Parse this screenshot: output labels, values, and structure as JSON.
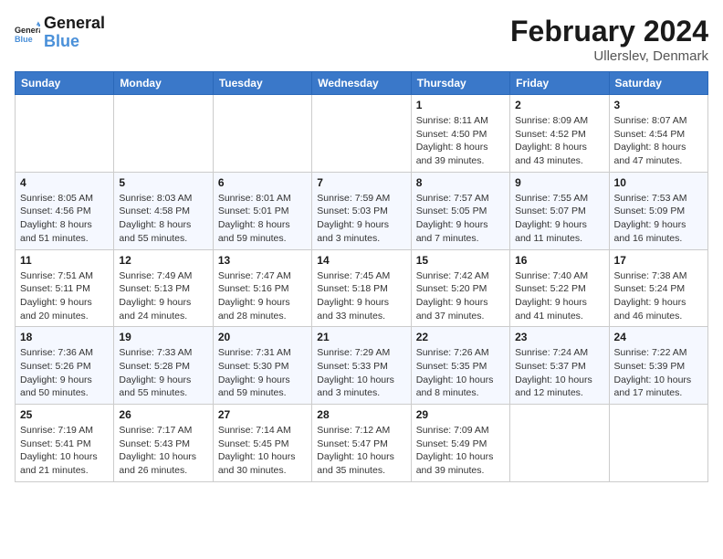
{
  "logo": {
    "text_general": "General",
    "text_blue": "Blue"
  },
  "title": "February 2024",
  "location": "Ullerslev, Denmark",
  "days_of_week": [
    "Sunday",
    "Monday",
    "Tuesday",
    "Wednesday",
    "Thursday",
    "Friday",
    "Saturday"
  ],
  "weeks": [
    [
      {
        "day": "",
        "info": ""
      },
      {
        "day": "",
        "info": ""
      },
      {
        "day": "",
        "info": ""
      },
      {
        "day": "",
        "info": ""
      },
      {
        "day": "1",
        "info": "Sunrise: 8:11 AM\nSunset: 4:50 PM\nDaylight: 8 hours\nand 39 minutes."
      },
      {
        "day": "2",
        "info": "Sunrise: 8:09 AM\nSunset: 4:52 PM\nDaylight: 8 hours\nand 43 minutes."
      },
      {
        "day": "3",
        "info": "Sunrise: 8:07 AM\nSunset: 4:54 PM\nDaylight: 8 hours\nand 47 minutes."
      }
    ],
    [
      {
        "day": "4",
        "info": "Sunrise: 8:05 AM\nSunset: 4:56 PM\nDaylight: 8 hours\nand 51 minutes."
      },
      {
        "day": "5",
        "info": "Sunrise: 8:03 AM\nSunset: 4:58 PM\nDaylight: 8 hours\nand 55 minutes."
      },
      {
        "day": "6",
        "info": "Sunrise: 8:01 AM\nSunset: 5:01 PM\nDaylight: 8 hours\nand 59 minutes."
      },
      {
        "day": "7",
        "info": "Sunrise: 7:59 AM\nSunset: 5:03 PM\nDaylight: 9 hours\nand 3 minutes."
      },
      {
        "day": "8",
        "info": "Sunrise: 7:57 AM\nSunset: 5:05 PM\nDaylight: 9 hours\nand 7 minutes."
      },
      {
        "day": "9",
        "info": "Sunrise: 7:55 AM\nSunset: 5:07 PM\nDaylight: 9 hours\nand 11 minutes."
      },
      {
        "day": "10",
        "info": "Sunrise: 7:53 AM\nSunset: 5:09 PM\nDaylight: 9 hours\nand 16 minutes."
      }
    ],
    [
      {
        "day": "11",
        "info": "Sunrise: 7:51 AM\nSunset: 5:11 PM\nDaylight: 9 hours\nand 20 minutes."
      },
      {
        "day": "12",
        "info": "Sunrise: 7:49 AM\nSunset: 5:13 PM\nDaylight: 9 hours\nand 24 minutes."
      },
      {
        "day": "13",
        "info": "Sunrise: 7:47 AM\nSunset: 5:16 PM\nDaylight: 9 hours\nand 28 minutes."
      },
      {
        "day": "14",
        "info": "Sunrise: 7:45 AM\nSunset: 5:18 PM\nDaylight: 9 hours\nand 33 minutes."
      },
      {
        "day": "15",
        "info": "Sunrise: 7:42 AM\nSunset: 5:20 PM\nDaylight: 9 hours\nand 37 minutes."
      },
      {
        "day": "16",
        "info": "Sunrise: 7:40 AM\nSunset: 5:22 PM\nDaylight: 9 hours\nand 41 minutes."
      },
      {
        "day": "17",
        "info": "Sunrise: 7:38 AM\nSunset: 5:24 PM\nDaylight: 9 hours\nand 46 minutes."
      }
    ],
    [
      {
        "day": "18",
        "info": "Sunrise: 7:36 AM\nSunset: 5:26 PM\nDaylight: 9 hours\nand 50 minutes."
      },
      {
        "day": "19",
        "info": "Sunrise: 7:33 AM\nSunset: 5:28 PM\nDaylight: 9 hours\nand 55 minutes."
      },
      {
        "day": "20",
        "info": "Sunrise: 7:31 AM\nSunset: 5:30 PM\nDaylight: 9 hours\nand 59 minutes."
      },
      {
        "day": "21",
        "info": "Sunrise: 7:29 AM\nSunset: 5:33 PM\nDaylight: 10 hours\nand 3 minutes."
      },
      {
        "day": "22",
        "info": "Sunrise: 7:26 AM\nSunset: 5:35 PM\nDaylight: 10 hours\nand 8 minutes."
      },
      {
        "day": "23",
        "info": "Sunrise: 7:24 AM\nSunset: 5:37 PM\nDaylight: 10 hours\nand 12 minutes."
      },
      {
        "day": "24",
        "info": "Sunrise: 7:22 AM\nSunset: 5:39 PM\nDaylight: 10 hours\nand 17 minutes."
      }
    ],
    [
      {
        "day": "25",
        "info": "Sunrise: 7:19 AM\nSunset: 5:41 PM\nDaylight: 10 hours\nand 21 minutes."
      },
      {
        "day": "26",
        "info": "Sunrise: 7:17 AM\nSunset: 5:43 PM\nDaylight: 10 hours\nand 26 minutes."
      },
      {
        "day": "27",
        "info": "Sunrise: 7:14 AM\nSunset: 5:45 PM\nDaylight: 10 hours\nand 30 minutes."
      },
      {
        "day": "28",
        "info": "Sunrise: 7:12 AM\nSunset: 5:47 PM\nDaylight: 10 hours\nand 35 minutes."
      },
      {
        "day": "29",
        "info": "Sunrise: 7:09 AM\nSunset: 5:49 PM\nDaylight: 10 hours\nand 39 minutes."
      },
      {
        "day": "",
        "info": ""
      },
      {
        "day": "",
        "info": ""
      }
    ]
  ]
}
